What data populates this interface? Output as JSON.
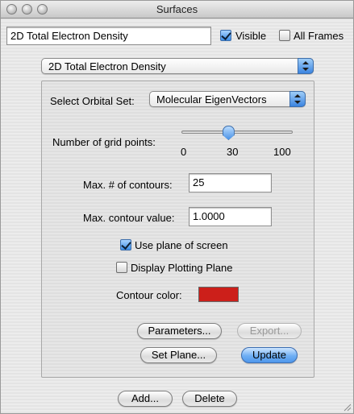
{
  "window": {
    "title": "Surfaces"
  },
  "header": {
    "surface_name": "2D Total Electron Density",
    "visible_label": "Visible",
    "visible_checked": true,
    "all_frames_label": "All Frames",
    "all_frames_checked": false
  },
  "surface_type_popup": {
    "selected": "2D Total Electron Density"
  },
  "panel": {
    "orbital_set_label": "Select Orbital Set:",
    "orbital_set_selected": "Molecular EigenVectors",
    "grid_points_label": "Number of grid points:",
    "grid_points_value": 30,
    "grid_points_min": 0,
    "grid_points_max": 100,
    "tick_min": "0",
    "tick_mid": "30",
    "tick_max": "100",
    "max_contours_label": "Max. # of contours:",
    "max_contours_value": "25",
    "max_contour_value_label": "Max. contour value:",
    "max_contour_value_value": "1.0000",
    "use_plane_label": "Use plane of screen",
    "use_plane_checked": true,
    "display_plotting_plane_label": "Display Plotting Plane",
    "display_plotting_plane_checked": false,
    "contour_color_label": "Contour color:",
    "contour_color": "#cc1f1a",
    "parameters_button": "Parameters...",
    "export_button": "Export...",
    "set_plane_button": "Set Plane...",
    "update_button": "Update"
  },
  "footer": {
    "add_button": "Add...",
    "delete_button": "Delete"
  }
}
